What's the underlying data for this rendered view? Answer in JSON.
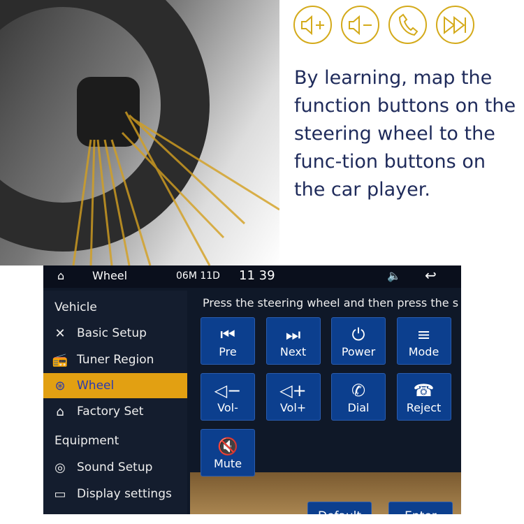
{
  "promo": {
    "icons": [
      "volume-up-icon",
      "volume-down-icon",
      "phone-icon",
      "next-track-icon"
    ],
    "description": "By learning, map the function buttons on the steering wheel to the func-tion buttons on the car player.",
    "accent": "#d4aa1a"
  },
  "topbar": {
    "title": "Wheel",
    "date": "06M 11D",
    "time": "11 39"
  },
  "sidebar": {
    "sections": [
      {
        "header": "Vehicle",
        "items": [
          {
            "label": "Basic Setup",
            "icon": "tools-icon"
          },
          {
            "label": "Tuner Region",
            "icon": "radio-icon"
          },
          {
            "label": "Wheel",
            "icon": "steering-wheel-icon",
            "selected": true
          },
          {
            "label": "Factory Set",
            "icon": "house-gear-icon"
          }
        ]
      },
      {
        "header": "Equipment",
        "items": [
          {
            "label": "Sound Setup",
            "icon": "speaker-icon"
          },
          {
            "label": "Display settings",
            "icon": "monitor-icon"
          }
        ]
      }
    ],
    "selected_color": "#e2a012"
  },
  "main": {
    "hint": "Press the steering wheel and then press the s",
    "buttons": [
      {
        "label": "Pre",
        "glyph": "⏮"
      },
      {
        "label": "Next",
        "glyph": "⏭"
      },
      {
        "label": "Power",
        "glyph": "⏻"
      },
      {
        "label": "Mode",
        "glyph": "≡"
      },
      {
        "label": "Vol-",
        "glyph": "◁−"
      },
      {
        "label": "Vol+",
        "glyph": "◁+"
      },
      {
        "label": "Dial",
        "glyph": "✆"
      },
      {
        "label": "Reject",
        "glyph": "☎"
      },
      {
        "label": "Mute",
        "glyph": "🔇"
      }
    ],
    "default_label": "Default",
    "enter_label": "Enter"
  }
}
